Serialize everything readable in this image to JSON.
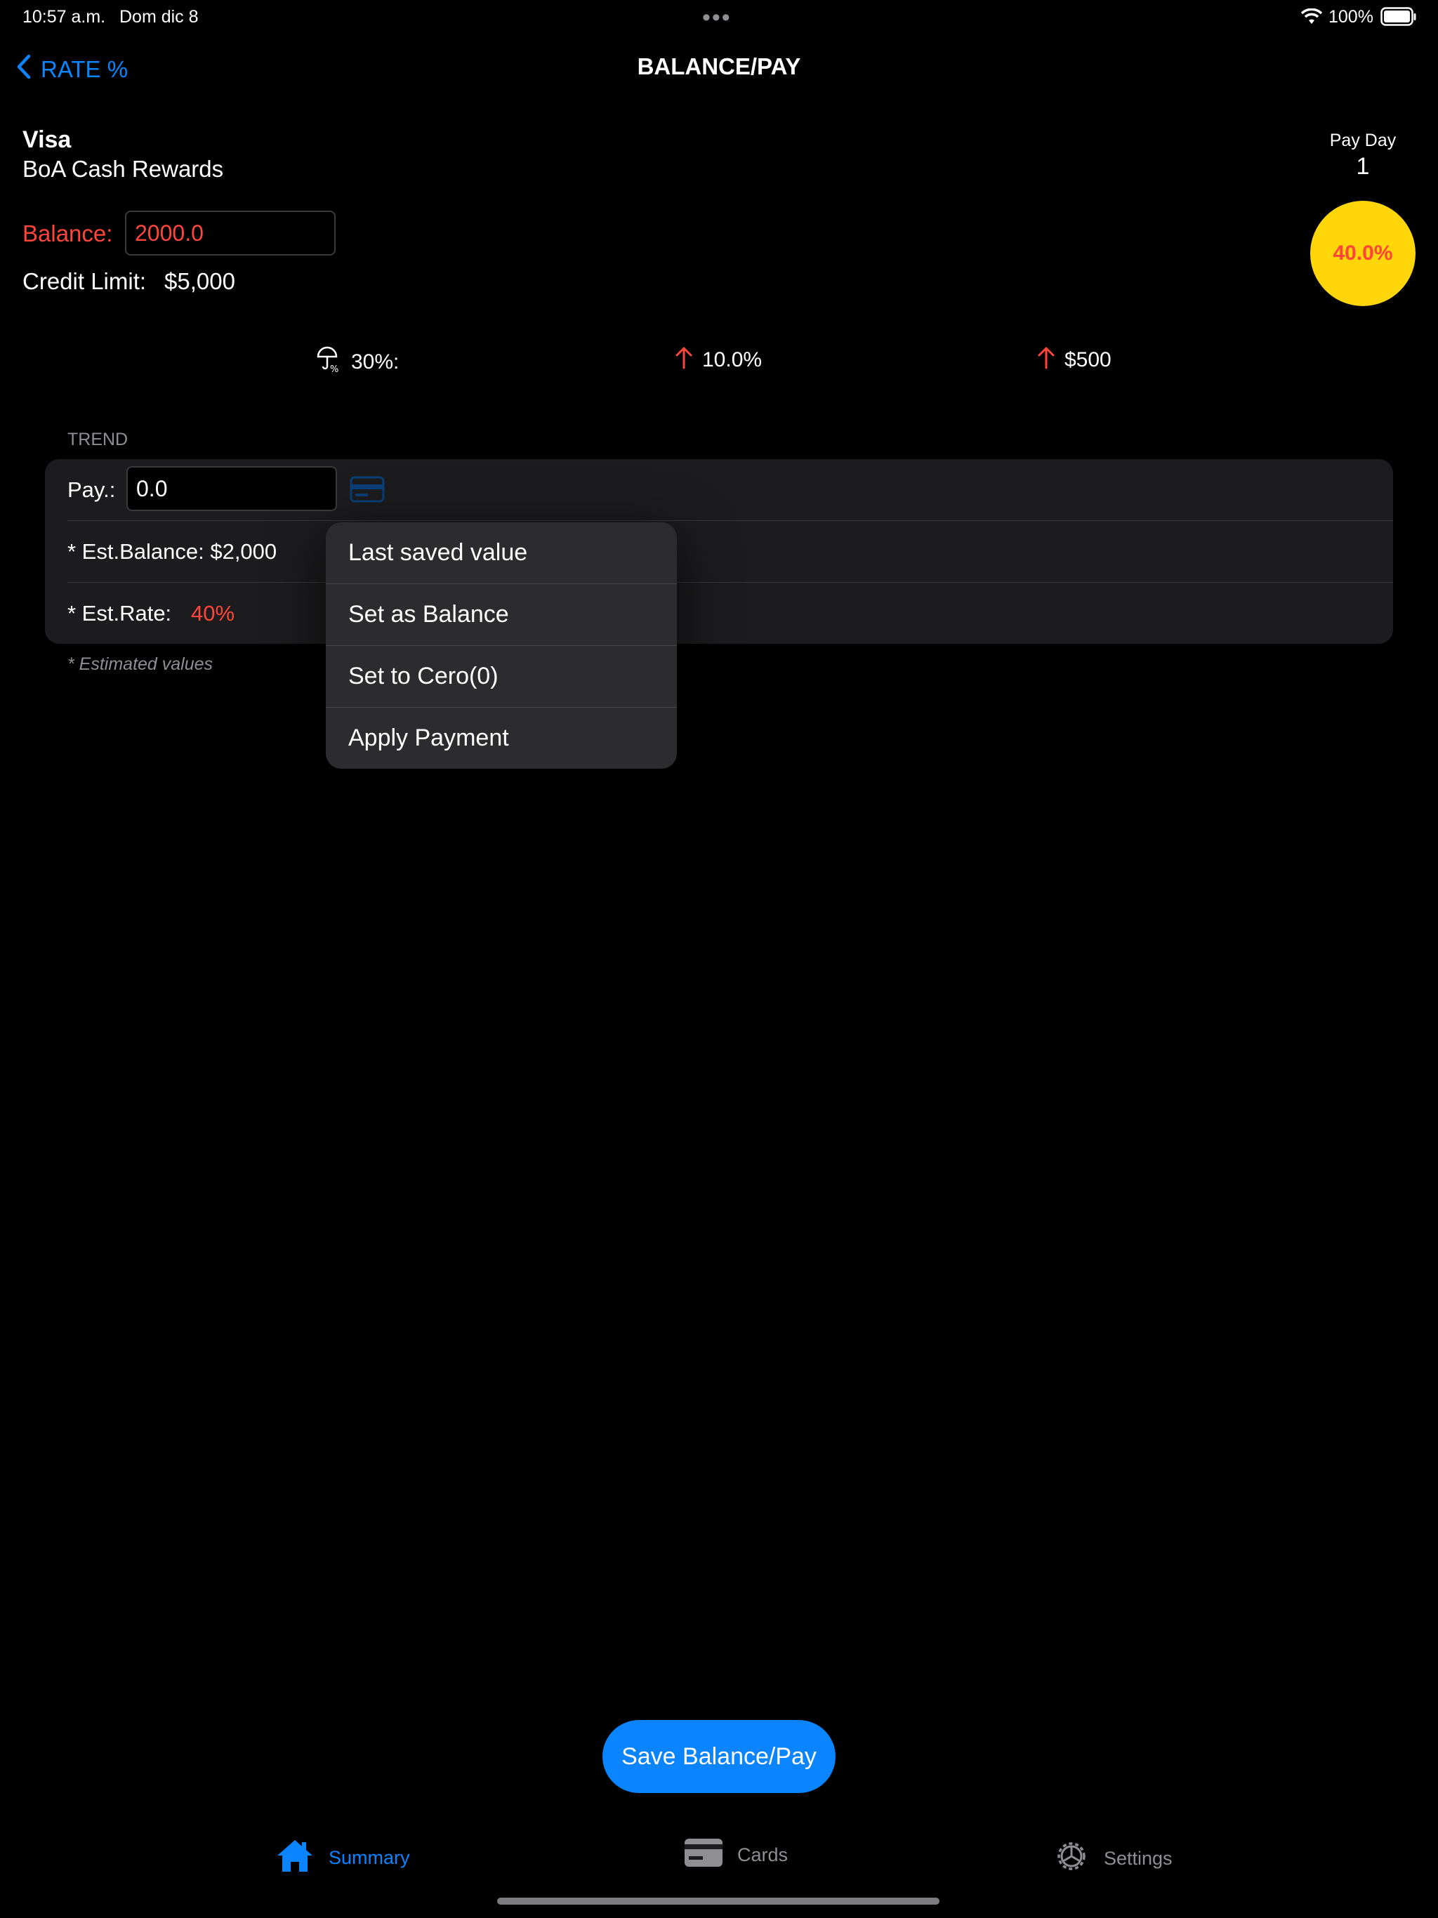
{
  "status_bar": {
    "time": "10:57 a.m.",
    "date": "Dom dic 8",
    "battery": "100%"
  },
  "nav": {
    "back_label": "RATE %",
    "title": "BALANCE/PAY"
  },
  "card": {
    "brand": "Visa",
    "name": "BoA Cash Rewards",
    "balance_label": "Balance:",
    "balance_value": "2000.0",
    "credit_limit_label": "Credit Limit:",
    "credit_limit_value": "$5,000"
  },
  "pay_day": {
    "label": "Pay Day",
    "value": "1",
    "rate": "40.0%"
  },
  "stats": [
    {
      "icon": "umbrella-percent-icon",
      "text": "30%:"
    },
    {
      "icon": "arrow-up-icon",
      "text": "10.0%"
    },
    {
      "icon": "arrow-up-icon",
      "text": "$500"
    }
  ],
  "trend": {
    "header": "TREND",
    "pay_label": "Pay.:",
    "pay_value": "0.0",
    "est_balance": "* Est.Balance: $2,000",
    "est_rate_label": "* Est.Rate:",
    "est_rate_value": "40%",
    "footnote": "* Estimated values"
  },
  "menu": [
    "Last saved value",
    "Set as Balance",
    "Set to Cero(0)",
    "Apply Payment"
  ],
  "save_button": "Save Balance/Pay",
  "tabs": [
    {
      "label": "Summary",
      "icon": "house-icon",
      "selected": true
    },
    {
      "label": "Cards",
      "icon": "credit-card-icon",
      "selected": false
    },
    {
      "label": "Settings",
      "icon": "gear-icon",
      "selected": false
    }
  ],
  "colors": {
    "accent": "#0a84ff",
    "red": "#ff453a",
    "yellow": "#ffd60a"
  }
}
